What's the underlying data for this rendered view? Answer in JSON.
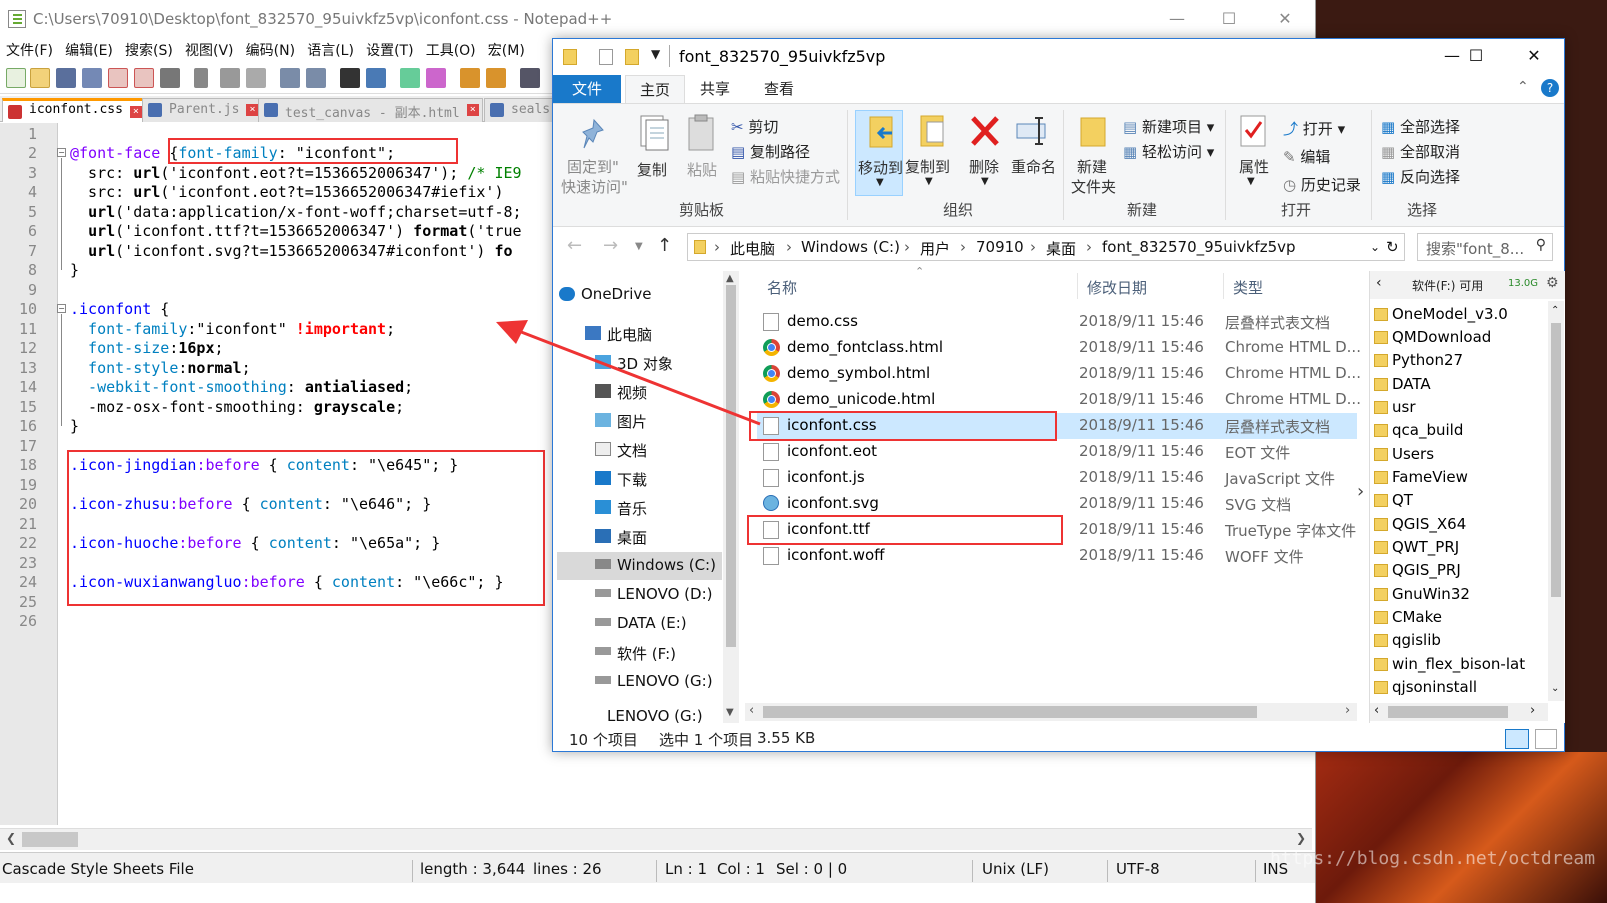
{
  "notepad": {
    "title": "C:\\Users\\70910\\Desktop\\font_832570_95uivkfz5vp\\iconfont.css - Notepad++",
    "menu": [
      "文件(F)",
      "编辑(E)",
      "搜索(S)",
      "视图(V)",
      "编码(N)",
      "语言(L)",
      "设置(T)",
      "工具(O)",
      "宏(M)"
    ],
    "tabs": [
      "iconfont.css",
      "Parent.js",
      "test_canvas - 副本.html",
      "seals"
    ],
    "line_numbers": [
      "1",
      "2",
      "3",
      "4",
      "5",
      "6",
      "7",
      "8",
      "9",
      "10",
      "11",
      "12",
      "13",
      "14",
      "15",
      "16",
      "17",
      "18",
      "19",
      "20",
      "21",
      "22",
      "23",
      "24",
      "25",
      "26"
    ],
    "code": {
      "l2_a": "@font-face",
      "l2_b": " {",
      "l2_c": "font-family",
      "l2_d": ": \"iconfont\";",
      "l3_a": "  src: ",
      "l3_b": "url",
      "l3_c": "('iconfont.eot?t=1536652006347'); ",
      "l3_d": "/* IE9",
      "l4_a": "  src: ",
      "l4_b": "url",
      "l4_c": "('iconfont.eot?t=1536652006347#iefix') ",
      "l5_a": "  ",
      "l5_b": "url",
      "l5_c": "('data:application/x-font-woff;charset=utf-8;",
      "l6_a": "  ",
      "l6_b": "url",
      "l6_c": "('iconfont.ttf?t=1536652006347') ",
      "l6_d": "format",
      "l6_e": "('true",
      "l7_a": "  ",
      "l7_b": "url",
      "l7_c": "('iconfont.svg?t=1536652006347#iconfont') ",
      "l7_d": "fo",
      "l8": "}",
      "l10_a": ".iconfont",
      "l10_b": " {",
      "l11_a": "  font-family",
      "l11_b": ":\"iconfont\" ",
      "l11_c": "!important",
      "l11_d": ";",
      "l12_a": "  font-size",
      "l12_b": ":",
      "l12_c": "16px",
      "l12_d": ";",
      "l13_a": "  font-style",
      "l13_b": ":",
      "l13_c": "normal",
      "l13_d": ";",
      "l14_a": "  -webkit-font-smoothing",
      "l14_b": ": ",
      "l14_c": "antialiased",
      "l14_d": ";",
      "l15_a": "  -moz-osx-font-smoothing: ",
      "l15_b": "grayscale",
      "l15_c": ";",
      "l16": "}",
      "l18_a": ".icon-jingdian",
      "l18_b": ":before",
      "l18_c": " { ",
      "l18_d": "content",
      "l18_e": ": \"\\e645\"; }",
      "l20_a": ".icon-zhusu",
      "l20_b": ":before",
      "l20_c": " { ",
      "l20_d": "content",
      "l20_e": ": \"\\e646\"; }",
      "l22_a": ".icon-huoche",
      "l22_b": ":before",
      "l22_c": " { ",
      "l22_d": "content",
      "l22_e": ": \"\\e65a\"; }",
      "l24_a": ".icon-wuxianwangluo",
      "l24_b": ":before",
      "l24_c": " { ",
      "l24_d": "content",
      "l24_e": ": \"\\e66c\"; }"
    },
    "status": {
      "filetype": "Cascade Style Sheets File",
      "length": "length : 3,644",
      "lines": "lines : 26",
      "ln": "Ln : 1",
      "col": "Col : 1",
      "sel": "Sel : 0 | 0",
      "eol": "Unix (LF)",
      "encoding": "UTF-8",
      "ins": "INS"
    }
  },
  "explorer": {
    "title": "font_832570_95uivkfz5vp",
    "ribbon_tabs": [
      "文件",
      "主页",
      "共享",
      "查看"
    ],
    "clipboard": {
      "pin": "固定到\"",
      "pin2": "快速访问\"",
      "copy": "复制",
      "paste": "粘贴",
      "cut": "剪切",
      "copy_path": "复制路径",
      "paste_shortcut": "粘贴快捷方式",
      "group": "剪贴板"
    },
    "organize": {
      "move_to": "移动到",
      "copy_to": "复制到",
      "delete": "删除",
      "rename": "重命名",
      "group": "组织"
    },
    "new": {
      "new_folder": "新建",
      "new_folder2": "文件夹",
      "new_item": "新建项目",
      "easy_access": "轻松访问",
      "group": "新建"
    },
    "open": {
      "properties": "属性",
      "open": "打开",
      "edit": "编辑",
      "history": "历史记录",
      "group": "打开"
    },
    "select": {
      "select_all": "全部选择",
      "select_none": "全部取消",
      "invert": "反向选择",
      "group": "选择"
    },
    "breadcrumb": [
      "此电脑",
      "Windows (C:)",
      "用户",
      "70910",
      "桌面",
      "font_832570_95uivkfz5vp"
    ],
    "search_placeholder": "搜索\"font_8...",
    "nav": [
      "OneDrive",
      "此电脑",
      "3D 对象",
      "视频",
      "图片",
      "文档",
      "下载",
      "音乐",
      "桌面",
      "Windows (C:)",
      "LENOVO (D:)",
      "DATA (E:)",
      "软件 (F:)",
      "LENOVO (G:)",
      "LENOVO (G:)"
    ],
    "columns": [
      "名称",
      "修改日期",
      "类型"
    ],
    "files": [
      {
        "name": "demo.css",
        "date": "2018/9/11 15:46",
        "type": "层叠样式表文档"
      },
      {
        "name": "demo_fontclass.html",
        "date": "2018/9/11 15:46",
        "type": "Chrome HTML D..."
      },
      {
        "name": "demo_symbol.html",
        "date": "2018/9/11 15:46",
        "type": "Chrome HTML D..."
      },
      {
        "name": "demo_unicode.html",
        "date": "2018/9/11 15:46",
        "type": "Chrome HTML D..."
      },
      {
        "name": "iconfont.css",
        "date": "2018/9/11 15:46",
        "type": "层叠样式表文档"
      },
      {
        "name": "iconfont.eot",
        "date": "2018/9/11 15:46",
        "type": "EOT 文件"
      },
      {
        "name": "iconfont.js",
        "date": "2018/9/11 15:46",
        "type": "JavaScript 文件"
      },
      {
        "name": "iconfont.svg",
        "date": "2018/9/11 15:46",
        "type": "SVG 文档"
      },
      {
        "name": "iconfont.ttf",
        "date": "2018/9/11 15:46",
        "type": "TrueType 字体文件"
      },
      {
        "name": "iconfont.woff",
        "date": "2018/9/11 15:46",
        "type": "WOFF 文件"
      }
    ],
    "right_pane": {
      "header": "软件(F:) 可用",
      "free": "13.0G",
      "items": [
        "OneModel_v3.0",
        "QMDownload",
        "Python27",
        "DATA",
        "usr",
        "qca_build",
        "Users",
        "FameView",
        "QT",
        "QGIS_X64",
        "QWT_PRJ",
        "QGIS_PRJ",
        "GnuWin32",
        "CMake",
        "qgislib",
        "win_flex_bison-lat",
        "qjsoninstall"
      ]
    },
    "status": {
      "count": "10 个项目",
      "selected": "选中 1 个项目",
      "size": "3.55 KB"
    }
  },
  "watermark": "https://blog.csdn.net/octdream",
  "colors": {
    "accent": "#1979ca",
    "highlight_box": "#e33333",
    "selection": "#cce8ff"
  }
}
